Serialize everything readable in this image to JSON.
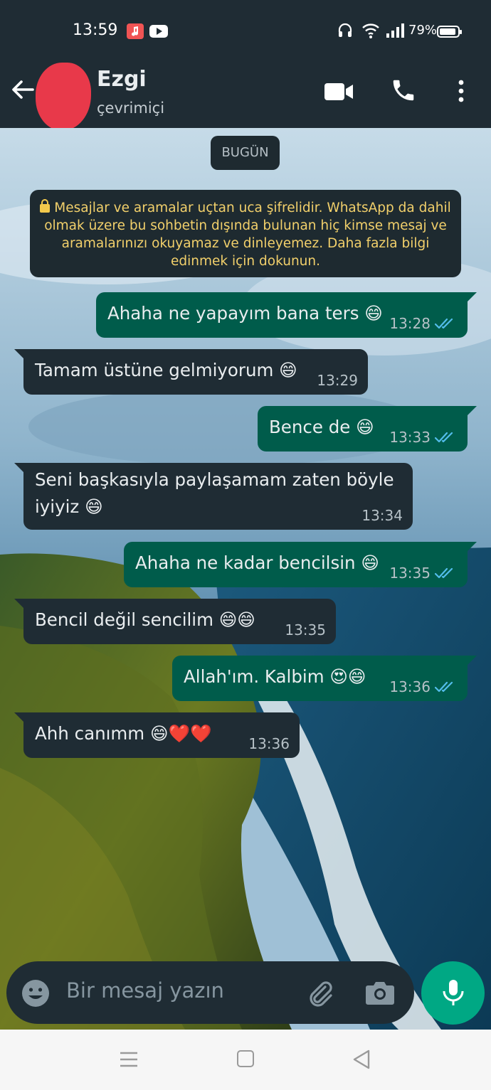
{
  "status_bar": {
    "time": "13:59",
    "battery": "79%"
  },
  "header": {
    "contact_name": "Ezgi",
    "contact_status": "çevrimiçi"
  },
  "chat": {
    "date_chip": "BUGÜN",
    "encryption_notice": "Mesajlar ve aramalar uçtan uca şifrelidir. WhatsApp da dahil olmak üzere bu sohbetin dışında bulunan hiç kimse mesaj ve aramalarınızı okuyamaz ve dinleyemez. Daha fazla bilgi edinmek için dokunun.",
    "messages": [
      {
        "direction": "out",
        "text": "Ahaha ne yapayım bana ters 😄",
        "time": "13:28",
        "read": true
      },
      {
        "direction": "in",
        "text": "Tamam üstüne gelmiyorum 😄",
        "time": "13:29"
      },
      {
        "direction": "out",
        "text": "Bence de 😄",
        "time": "13:33",
        "read": true
      },
      {
        "direction": "in",
        "text_line1": "Seni başkasıyla paylaşamam zaten böyle",
        "text_line2": "iyiyiz 😄",
        "time": "13:34"
      },
      {
        "direction": "out",
        "text": "Ahaha ne kadar bencilsin 😄",
        "time": "13:35",
        "read": true
      },
      {
        "direction": "in",
        "text": "Bencil değil sencilim 😄😄",
        "time": "13:35"
      },
      {
        "direction": "out",
        "text": "Allah'ım. Kalbim 😍😄",
        "time": "13:36",
        "read": true
      },
      {
        "direction": "in",
        "text": "Ahh canımm 😄❤️❤️",
        "time": "13:36"
      }
    ]
  },
  "composer": {
    "placeholder": "Bir mesaj yazın"
  },
  "icons": {
    "back": "arrow-left-icon",
    "video": "video-camera-icon",
    "call": "phone-icon",
    "more": "more-vertical-icon",
    "emoji": "smiley-icon",
    "attach": "paperclip-icon",
    "camera": "camera-icon",
    "mic": "microphone-icon"
  },
  "colors": {
    "header_bg": "#1f2c34",
    "outgoing_bubble": "#005c4b",
    "incoming_bubble": "#1f2c34",
    "read_ticks": "#53bdeb",
    "mic_button": "#00a884",
    "notice_text": "#f2d06b"
  }
}
